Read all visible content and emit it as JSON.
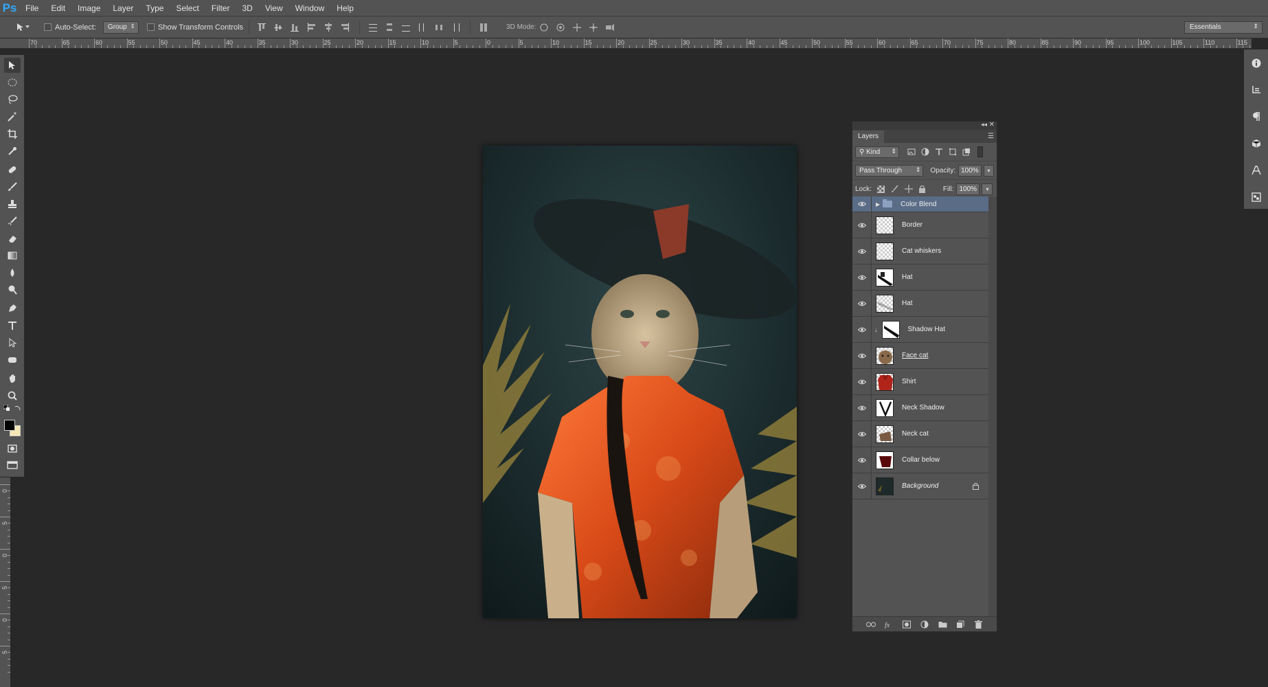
{
  "app": {
    "logo_text": "Ps"
  },
  "menu": [
    "File",
    "Edit",
    "Image",
    "Layer",
    "Type",
    "Select",
    "Filter",
    "3D",
    "View",
    "Window",
    "Help"
  ],
  "options_bar": {
    "auto_select_label": "Auto-Select:",
    "auto_select_value": "Group",
    "transform_controls_label": "Show Transform Controls",
    "mode_3d_label": "3D Mode:",
    "workspace": "Essentials"
  },
  "rulers": {
    "horizontal_labels": [
      "70",
      "65",
      "60",
      "55",
      "50",
      "45",
      "40",
      "35",
      "30",
      "25",
      "20",
      "15",
      "10",
      "5",
      "0",
      "5",
      "10",
      "15",
      "20",
      "25",
      "30",
      "35",
      "40",
      "45",
      "50",
      "55",
      "60",
      "65",
      "70",
      "75",
      "80",
      "85",
      "90",
      "95",
      "100",
      "105",
      "110",
      "115"
    ],
    "vertical_labels": [
      "0",
      "5",
      "0",
      "5",
      "0",
      "5"
    ]
  },
  "layers_panel": {
    "tab": "Layers",
    "filter_kind": "Kind",
    "blend_mode": "Pass Through",
    "opacity_label": "Opacity:",
    "opacity": "100%",
    "lock_label": "Lock:",
    "fill_label": "Fill:",
    "fill": "100%",
    "layers": [
      {
        "name": "Color Blend",
        "type": "group",
        "selected": true
      },
      {
        "name": "Border",
        "type": "transparent"
      },
      {
        "name": "Cat whiskers",
        "type": "transparent"
      },
      {
        "name": "Hat",
        "type": "hat-dark"
      },
      {
        "name": "Hat",
        "type": "hat-light"
      },
      {
        "name": "Shadow Hat",
        "type": "shadow-hat",
        "clipped": true
      },
      {
        "name": "Face cat",
        "type": "face"
      },
      {
        "name": "Shirt",
        "type": "shirt"
      },
      {
        "name": "Neck Shadow",
        "type": "neck-shadow"
      },
      {
        "name": "Neck cat",
        "type": "neck"
      },
      {
        "name": "Collar below",
        "type": "collar"
      },
      {
        "name": "Background",
        "type": "background",
        "locked": true
      }
    ]
  },
  "colors": {
    "foreground": "#000000",
    "background": "#f3e7b4",
    "accent": "#31a8ff",
    "group_highlight": "#5a6c86"
  }
}
